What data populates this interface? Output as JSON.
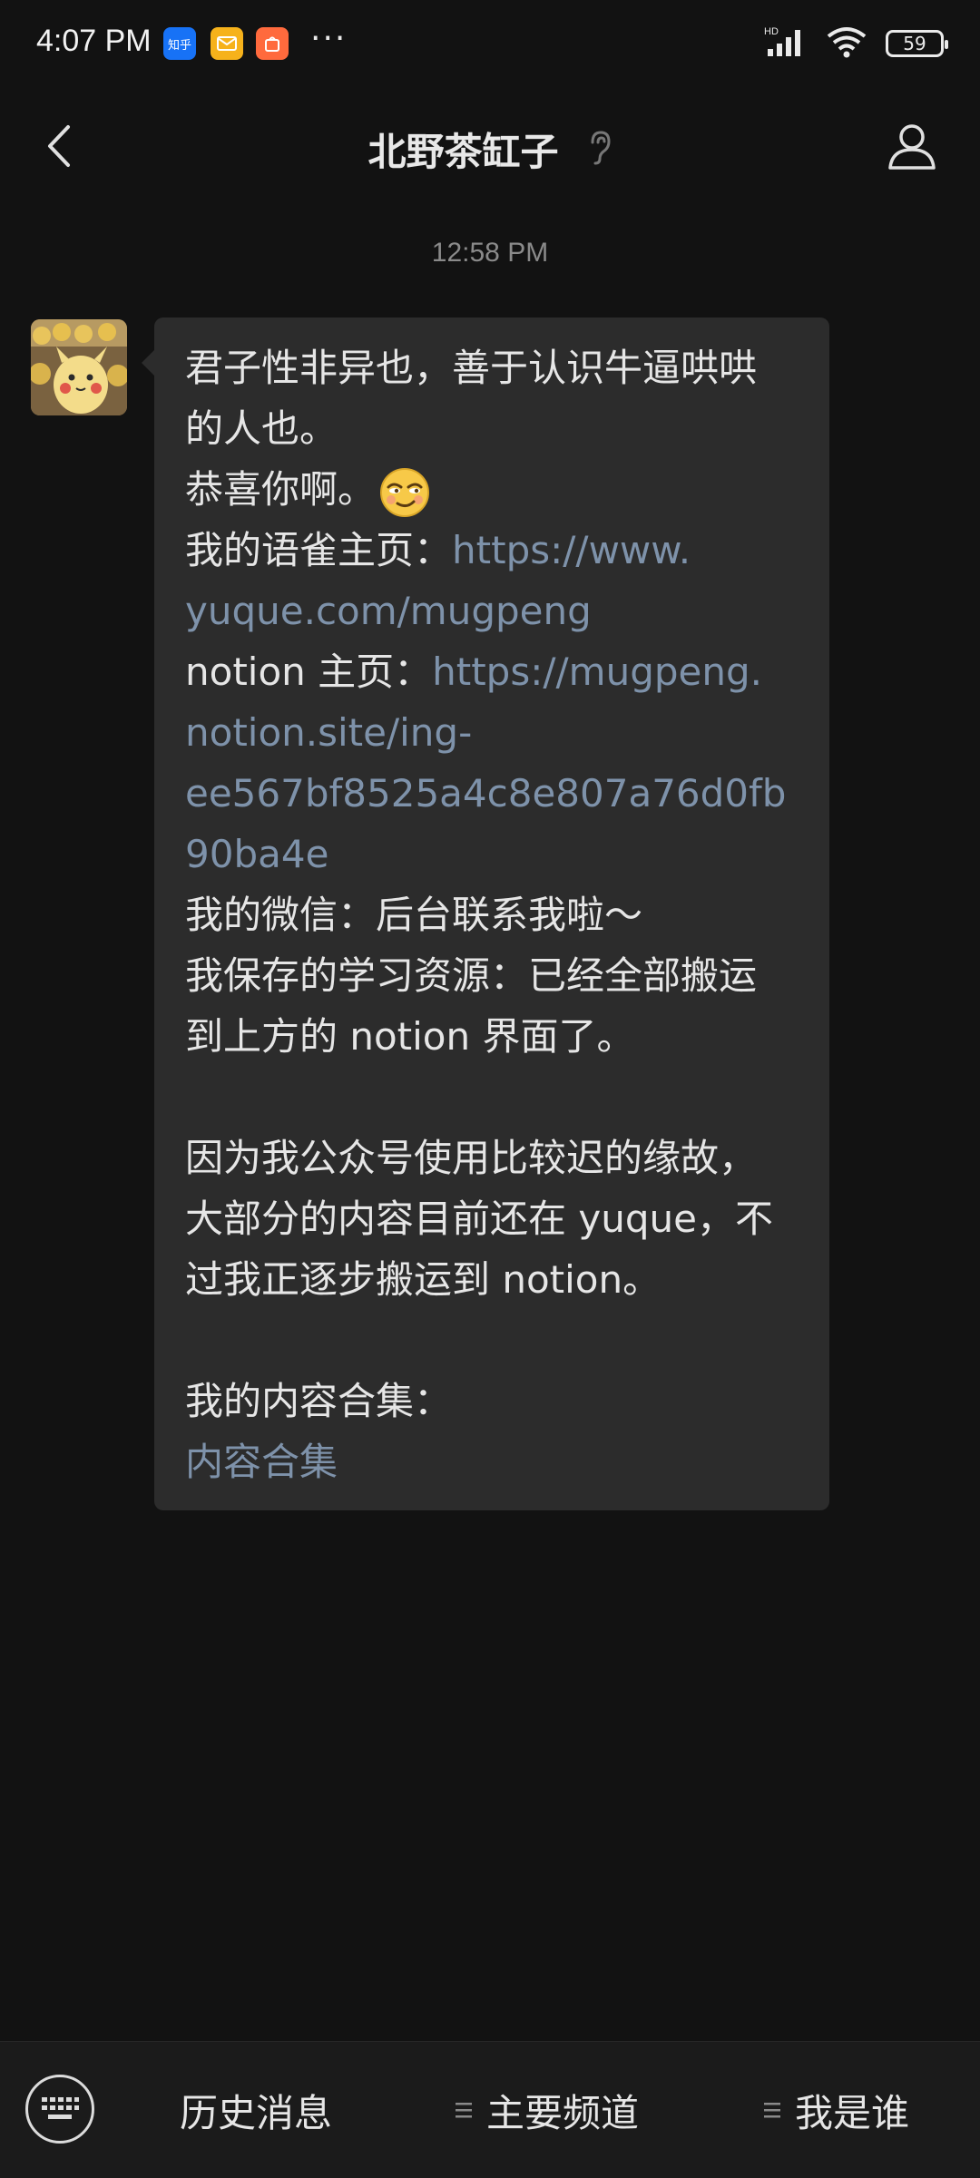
{
  "status_bar": {
    "time": "4:07 PM",
    "badges": [
      {
        "icon": "zhihu-app-icon",
        "text": "知乎"
      },
      {
        "icon": "mail-app-icon",
        "text": ""
      },
      {
        "icon": "shopping-app-icon",
        "text": ""
      }
    ],
    "more": "···",
    "network_label": "HD",
    "battery": "59"
  },
  "header": {
    "title": "北野茶缸子",
    "icons": {
      "back": "chevron-left-icon",
      "ear": "ear-icon",
      "profile": "person-icon"
    }
  },
  "conversation": {
    "timestamp": "12:58 PM",
    "message": {
      "lines": [
        {
          "parts": [
            {
              "text": "君子性非异也，善于认识牛逼哄哄",
              "link": false
            }
          ]
        },
        {
          "parts": [
            {
              "text": "的人也。",
              "link": false
            }
          ]
        },
        {
          "parts": [
            {
              "text": "恭喜你啊。",
              "link": false
            }
          ],
          "emoji": "smirk-emoji"
        },
        {
          "parts": [
            {
              "text": "我的语雀主页：",
              "link": false
            },
            {
              "text": "https://www.",
              "link": true
            }
          ]
        },
        {
          "parts": [
            {
              "text": "yuque.com/mugpeng",
              "link": true
            }
          ]
        },
        {
          "parts": [
            {
              "text": "notion 主页：",
              "link": false
            },
            {
              "text": "https://mugpeng.",
              "link": true
            }
          ]
        },
        {
          "parts": [
            {
              "text": "notion.site/ing-",
              "link": true
            }
          ]
        },
        {
          "parts": [
            {
              "text": "ee567bf8525a4c8e807a76d0fb",
              "link": true
            }
          ]
        },
        {
          "parts": [
            {
              "text": "90ba4e",
              "link": true
            }
          ]
        },
        {
          "parts": [
            {
              "text": "我的微信：后台联系我啦～",
              "link": false
            }
          ]
        },
        {
          "parts": [
            {
              "text": "我保存的学习资源：已经全部搬运",
              "link": false
            }
          ]
        },
        {
          "parts": [
            {
              "text": "到上方的 notion 界面了。",
              "link": false
            }
          ]
        },
        {
          "parts": []
        },
        {
          "parts": [
            {
              "text": "因为我公众号使用比较迟的缘故，",
              "link": false
            }
          ]
        },
        {
          "parts": [
            {
              "text": "大部分的内容目前还在 yuque，不",
              "link": false
            }
          ]
        },
        {
          "parts": [
            {
              "text": "过我正逐步搬运到 notion。",
              "link": false
            }
          ]
        },
        {
          "parts": []
        },
        {
          "parts": [
            {
              "text": "我的内容合集：",
              "link": false
            }
          ]
        },
        {
          "parts": [
            {
              "text": "内容合集",
              "link": true
            }
          ]
        }
      ]
    }
  },
  "bottom_bar": {
    "keyboard_icon": "keyboard-icon",
    "items": [
      {
        "label": "历史消息",
        "has_menu_icon": false
      },
      {
        "label": "主要频道",
        "has_menu_icon": true
      },
      {
        "label": "我是谁",
        "has_menu_icon": true
      }
    ]
  },
  "colors": {
    "background": "#121212",
    "bubble": "#2c2c2c",
    "link": "#7e92aa",
    "text": "#e6e6e6"
  }
}
